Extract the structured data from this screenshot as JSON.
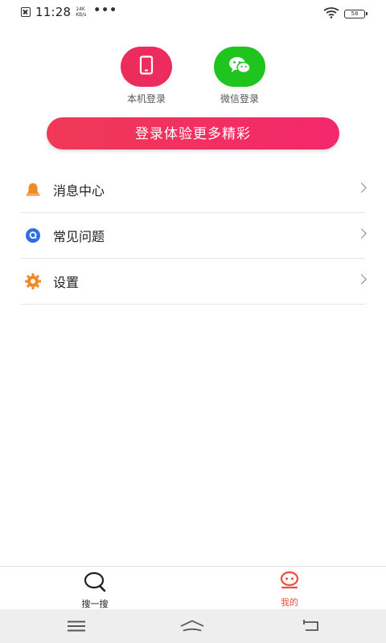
{
  "status_bar": {
    "time": "11:28",
    "net_speed": "14K KB/s",
    "dots": "•••",
    "battery": "58",
    "icons": [
      "sim-icon",
      "wifi-icon",
      "battery-icon"
    ]
  },
  "login_options": [
    {
      "label": "本机登录",
      "icon": "tablet-icon",
      "color": "#ec2c5c"
    },
    {
      "label": "微信登录",
      "icon": "wechat-icon",
      "color": "#1fc41f"
    }
  ],
  "login_button": {
    "label": "登录体验更多精彩"
  },
  "menu": [
    {
      "label": "消息中心",
      "icon": "bell-icon",
      "icon_color": "#f08a24"
    },
    {
      "label": "常见问题",
      "icon": "question-icon",
      "icon_color": "#2f6fe0"
    },
    {
      "label": "设置",
      "icon": "gear-icon",
      "icon_color": "#f08a24"
    }
  ],
  "tabs": [
    {
      "label": "搜一搜",
      "icon": "search-icon",
      "active": false
    },
    {
      "label": "我的",
      "icon": "profile-icon",
      "active": true
    }
  ],
  "colors": {
    "accent": "#ef3956",
    "wechat": "#1fc41f",
    "active_tab": "#e8503c"
  },
  "nav_bar": {
    "icons": [
      "menu-icon",
      "home-icon",
      "back-icon"
    ]
  }
}
